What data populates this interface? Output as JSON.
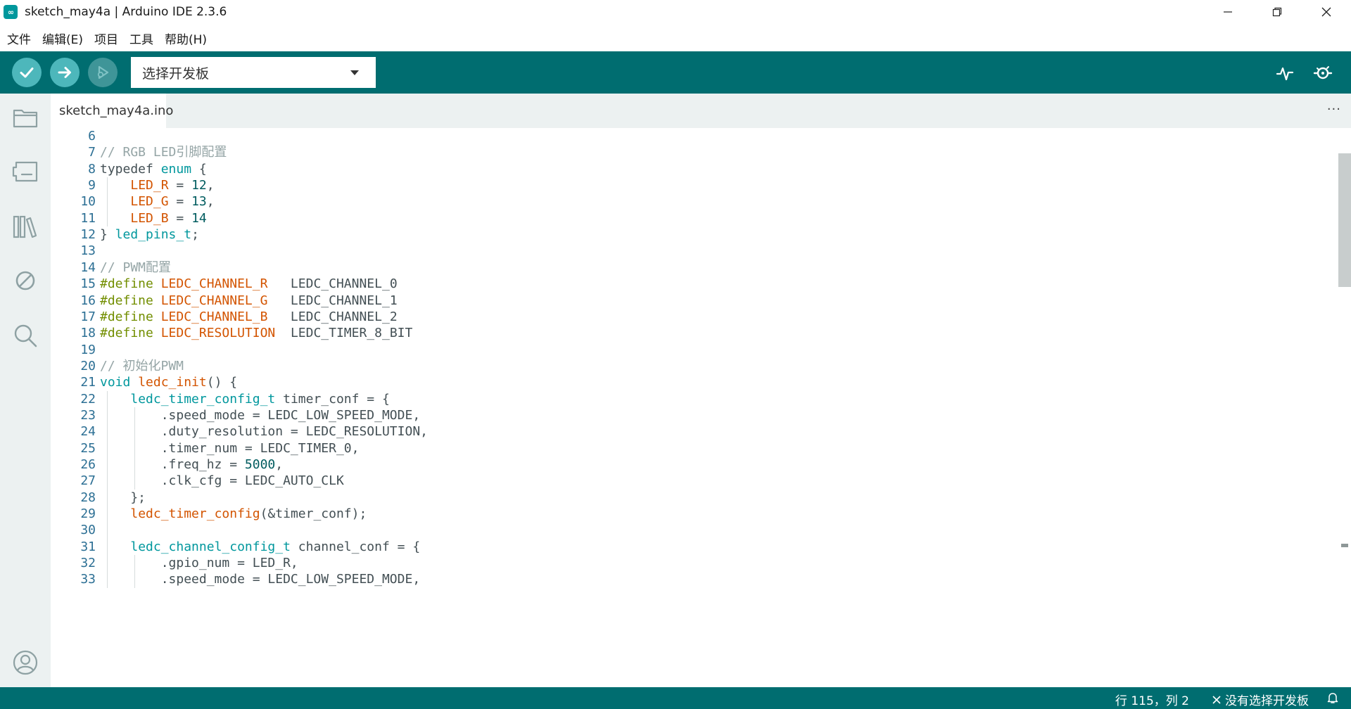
{
  "window": {
    "app_icon": "arduino-infinity-icon",
    "title": "sketch_may4a | Arduino IDE 2.3.6",
    "controls": [
      "minimize-icon",
      "restore-icon",
      "close-icon"
    ]
  },
  "menu": {
    "items": [
      "文件",
      "编辑(E)",
      "项目",
      "工具",
      "帮助(H)"
    ]
  },
  "toolbar": {
    "verify_icon": "check-icon",
    "upload_icon": "arrow-right-icon",
    "debug_icon": "debug-icon",
    "board_select_label": "选择开发板",
    "serial_plotter_icon": "plotter-icon",
    "serial_monitor_icon": "monitor-icon"
  },
  "sidebar": {
    "items": [
      "folder-icon",
      "board-manager-icon",
      "library-icon",
      "debug-icon",
      "search-icon"
    ],
    "bottom": "account-icon"
  },
  "tabs": [
    {
      "label": "sketch_may4a.ino",
      "active": true
    }
  ],
  "tab_more": "···",
  "editor": {
    "lines": [
      {
        "num": "6",
        "tokens": []
      },
      {
        "num": "7",
        "tokens": [
          {
            "t": "// RGB LED引脚配置",
            "c": "comment"
          }
        ]
      },
      {
        "num": "8",
        "tokens": [
          {
            "t": "typedef ",
            "c": "plain"
          },
          {
            "t": "enum",
            "c": "kw"
          },
          {
            "t": " {",
            "c": "plain"
          }
        ]
      },
      {
        "num": "9",
        "tokens": [
          {
            "t": "    ",
            "c": "plain"
          },
          {
            "t": "LED_R",
            "c": "const"
          },
          {
            "t": " = ",
            "c": "plain"
          },
          {
            "t": "12",
            "c": "num"
          },
          {
            "t": ",",
            "c": "plain"
          }
        ]
      },
      {
        "num": "10",
        "tokens": [
          {
            "t": "    ",
            "c": "plain"
          },
          {
            "t": "LED_G",
            "c": "const"
          },
          {
            "t": " = ",
            "c": "plain"
          },
          {
            "t": "13",
            "c": "num"
          },
          {
            "t": ",",
            "c": "plain"
          }
        ]
      },
      {
        "num": "11",
        "tokens": [
          {
            "t": "    ",
            "c": "plain"
          },
          {
            "t": "LED_B",
            "c": "const"
          },
          {
            "t": " = ",
            "c": "plain"
          },
          {
            "t": "14",
            "c": "num"
          }
        ]
      },
      {
        "num": "12",
        "tokens": [
          {
            "t": "} ",
            "c": "plain"
          },
          {
            "t": "led_pins_t",
            "c": "type"
          },
          {
            "t": ";",
            "c": "plain"
          }
        ]
      },
      {
        "num": "13",
        "tokens": []
      },
      {
        "num": "14",
        "tokens": [
          {
            "t": "// PWM配置",
            "c": "comment"
          }
        ]
      },
      {
        "num": "15",
        "tokens": [
          {
            "t": "#define ",
            "c": "pp"
          },
          {
            "t": "LEDC_CHANNEL_R",
            "c": "const"
          },
          {
            "t": "   LEDC_CHANNEL_0",
            "c": "plain"
          }
        ]
      },
      {
        "num": "16",
        "tokens": [
          {
            "t": "#define ",
            "c": "pp"
          },
          {
            "t": "LEDC_CHANNEL_G",
            "c": "const"
          },
          {
            "t": "   LEDC_CHANNEL_1",
            "c": "plain"
          }
        ]
      },
      {
        "num": "17",
        "tokens": [
          {
            "t": "#define ",
            "c": "pp"
          },
          {
            "t": "LEDC_CHANNEL_B",
            "c": "const"
          },
          {
            "t": "   LEDC_CHANNEL_2",
            "c": "plain"
          }
        ]
      },
      {
        "num": "18",
        "tokens": [
          {
            "t": "#define ",
            "c": "pp"
          },
          {
            "t": "LEDC_RESOLUTION",
            "c": "const"
          },
          {
            "t": "  LEDC_TIMER_8_BIT",
            "c": "plain"
          }
        ]
      },
      {
        "num": "19",
        "tokens": []
      },
      {
        "num": "20",
        "tokens": [
          {
            "t": "// 初始化PWM",
            "c": "comment"
          }
        ]
      },
      {
        "num": "21",
        "tokens": [
          {
            "t": "void",
            "c": "kw"
          },
          {
            "t": " ",
            "c": "plain"
          },
          {
            "t": "ledc_init",
            "c": "fn"
          },
          {
            "t": "() {",
            "c": "plain"
          }
        ]
      },
      {
        "num": "22",
        "tokens": [
          {
            "t": "    ",
            "c": "plain"
          },
          {
            "t": "ledc_timer_config_t",
            "c": "type"
          },
          {
            "t": " timer_conf = {",
            "c": "plain"
          }
        ]
      },
      {
        "num": "23",
        "tokens": [
          {
            "t": "        .speed_mode = LEDC_LOW_SPEED_MODE,",
            "c": "plain"
          }
        ]
      },
      {
        "num": "24",
        "tokens": [
          {
            "t": "        .duty_resolution = LEDC_RESOLUTION,",
            "c": "plain"
          }
        ]
      },
      {
        "num": "25",
        "tokens": [
          {
            "t": "        .timer_num = LEDC_TIMER_0,",
            "c": "plain"
          }
        ]
      },
      {
        "num": "26",
        "tokens": [
          {
            "t": "        .freq_hz = ",
            "c": "plain"
          },
          {
            "t": "5000",
            "c": "num"
          },
          {
            "t": ",",
            "c": "plain"
          }
        ]
      },
      {
        "num": "27",
        "tokens": [
          {
            "t": "        .clk_cfg = LEDC_AUTO_CLK",
            "c": "plain"
          }
        ]
      },
      {
        "num": "28",
        "tokens": [
          {
            "t": "    };",
            "c": "plain"
          }
        ]
      },
      {
        "num": "29",
        "tokens": [
          {
            "t": "    ",
            "c": "plain"
          },
          {
            "t": "ledc_timer_config",
            "c": "fn"
          },
          {
            "t": "(&timer_conf);",
            "c": "plain"
          }
        ]
      },
      {
        "num": "30",
        "tokens": []
      },
      {
        "num": "31",
        "tokens": [
          {
            "t": "    ",
            "c": "plain"
          },
          {
            "t": "ledc_channel_config_t",
            "c": "type"
          },
          {
            "t": " channel_conf = {",
            "c": "plain"
          }
        ]
      },
      {
        "num": "32",
        "tokens": [
          {
            "t": "        .gpio_num = LED_R,",
            "c": "plain"
          }
        ]
      },
      {
        "num": "33",
        "tokens": [
          {
            "t": "        .speed_mode = LEDC_LOW_SPEED_MODE,",
            "c": "plain"
          }
        ]
      }
    ]
  },
  "status": {
    "position": "行 115，列 2",
    "board": "没有选择开发板",
    "board_icon": "close-icon",
    "bell_icon": "bell-icon"
  },
  "colors": {
    "teal": "#006d70",
    "comment": "#95a5a6",
    "keyword": "#00979d",
    "preprocessor": "#728e00",
    "constant": "#d35400",
    "line_number": "#2c6f94"
  }
}
